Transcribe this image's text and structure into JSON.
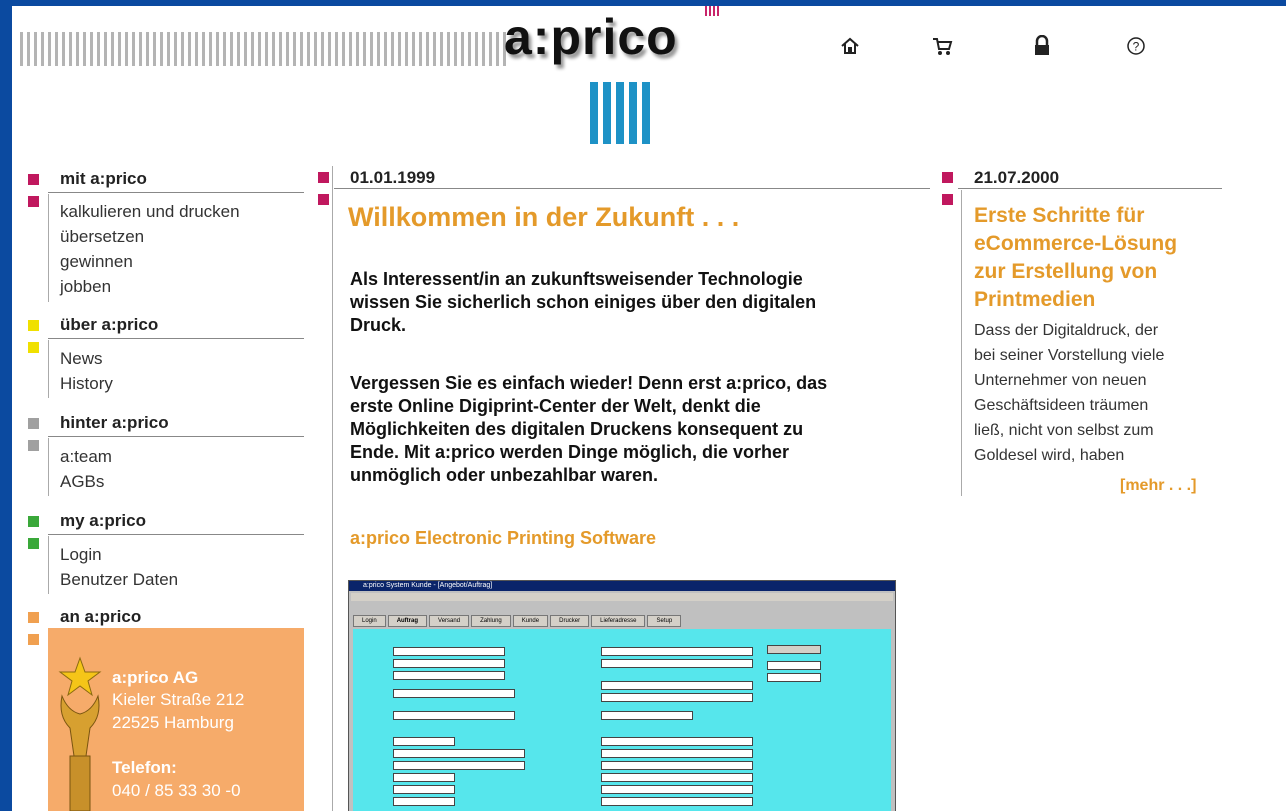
{
  "header": {
    "logo": "a:prico",
    "icons": [
      "home-icon",
      "cart-icon",
      "lock-icon",
      "help-icon"
    ],
    "icon_glyphs": [
      "⌂",
      "🛒",
      "🔒",
      "?"
    ]
  },
  "colors": {
    "accent": "#e49a2a",
    "frame": "#0b4aa0",
    "magenta": "#c0185e",
    "yellow": "#f0e000",
    "gray": "#a0a0a0",
    "green": "#3aa83a",
    "orange": "#f0a050",
    "contact_bg": "#f6ab6a"
  },
  "left_nav": {
    "sections": [
      {
        "title": "mit a:prico",
        "items": [
          "kalkulieren und drucken",
          "übersetzen",
          "gewinnen",
          "jobben"
        ]
      },
      {
        "title": "über a:prico",
        "items": [
          "News",
          "History"
        ]
      },
      {
        "title": "hinter a:prico",
        "items": [
          "a:team",
          "AGBs"
        ]
      },
      {
        "title": "my a:prico",
        "items": [
          "Login",
          "Benutzer Daten"
        ]
      },
      {
        "title": "an a:prico",
        "items": []
      }
    ],
    "contact": {
      "company": "a:prico AG",
      "street": "Kieler Straße 212",
      "city": "22525 Hamburg",
      "phone_label": "Telefon:",
      "phone": "040 / 85 33 30 -0"
    }
  },
  "main": {
    "date": "01.01.1999",
    "headline": "Willkommen in der Zukunft . . .",
    "paragraph1": [
      "Als Interessent/in an zukunftsweisender Technologie",
      "wissen Sie sicherlich schon einiges über den digitalen",
      "Druck."
    ],
    "paragraph2": [
      "Vergessen Sie es einfach wieder! Denn erst a:prico, das",
      "erste Online Digiprint-Center der Welt, denkt die",
      "Möglichkeiten des digitalen Druckens konsequent zu",
      "Ende. Mit a:prico werden Dinge möglich, die vorher",
      "unmöglich oder unbezahlbar waren."
    ],
    "subheading": "a:prico Electronic Printing Software",
    "screenshot": {
      "title": "a:prico System Kunde - [Angebot/Auftrag]",
      "tabs": [
        "Login",
        "Auftrag",
        "Versand",
        "Zahlung",
        "Kunde",
        "Drucker",
        "Lieferadresse",
        "Setup"
      ]
    }
  },
  "news": {
    "date": "21.07.2000",
    "headline": [
      "Erste Schritte für",
      "eCommerce-Lösung",
      "zur Erstellung von",
      "Printmedien"
    ],
    "text": [
      "Dass der Digitaldruck, der",
      "bei seiner Vorstellung viele",
      "Unternehmer von neuen",
      "Geschäftsideen träumen",
      "ließ, nicht von selbst zum",
      "Goldesel wird, haben"
    ],
    "more": "[mehr . . .]"
  }
}
